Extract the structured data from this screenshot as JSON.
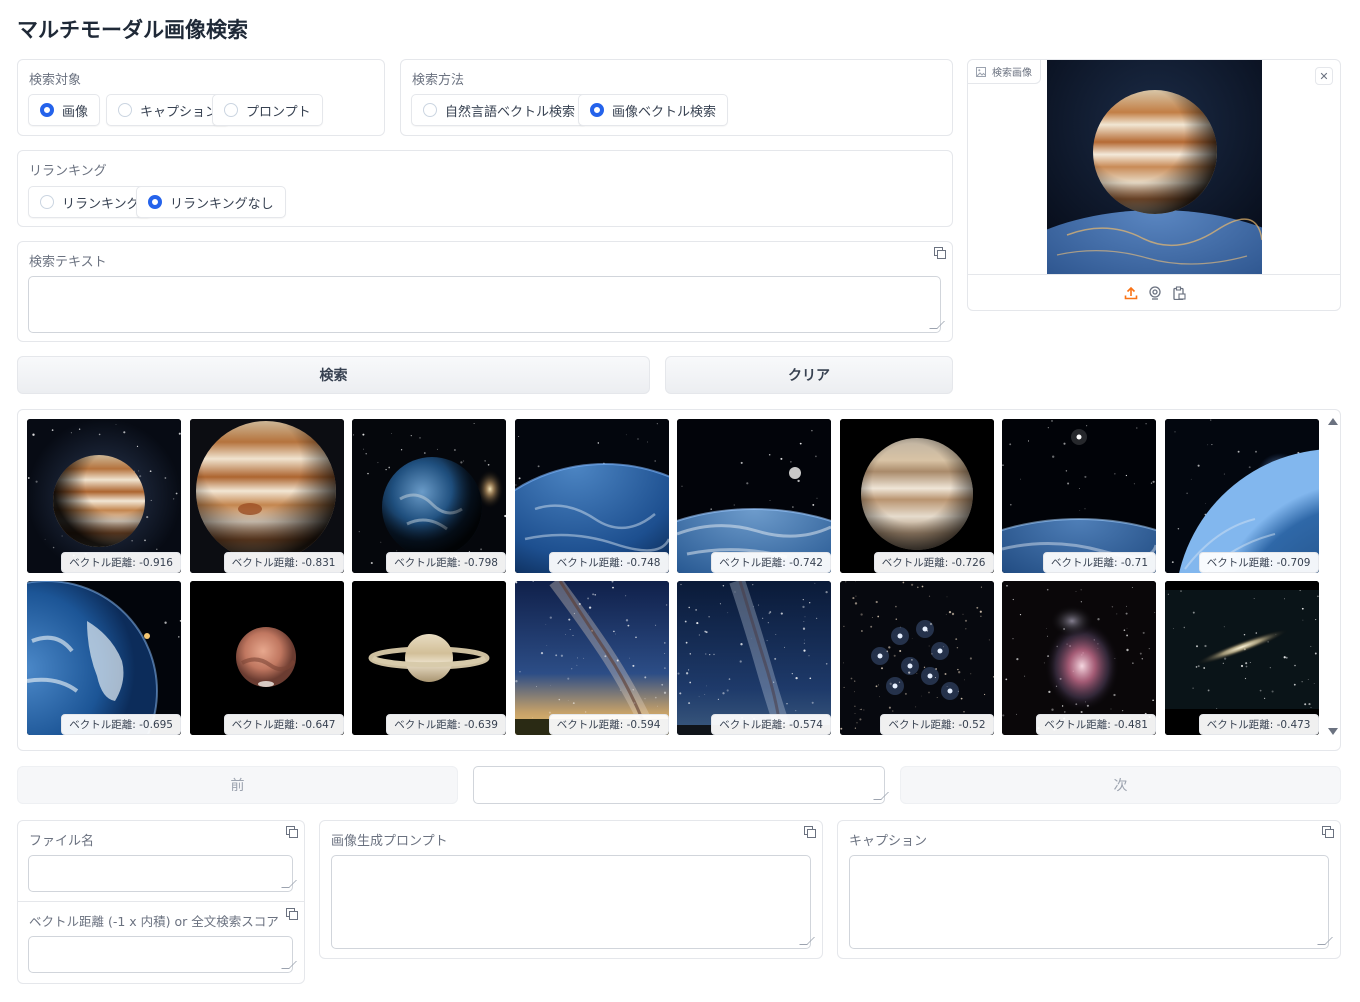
{
  "app": {
    "title": "マルチモーダル画像検索"
  },
  "search_target": {
    "label": "検索対象",
    "options": [
      "画像",
      "キャプション",
      "プロンプト"
    ],
    "selected": 0
  },
  "search_method": {
    "label": "検索方法",
    "options": [
      "自然言語ベクトル検索",
      "画像ベクトル検索"
    ],
    "selected": 1
  },
  "reranking": {
    "label": "リランキング",
    "options": [
      "リランキング",
      "リランキングなし"
    ],
    "selected": 1
  },
  "search_text": {
    "label": "検索テキスト",
    "value": ""
  },
  "search_image": {
    "label": "検索画像"
  },
  "buttons": {
    "search": "検索",
    "clear": "クリア",
    "prev": "前",
    "next": "次"
  },
  "page_field": {
    "value": ""
  },
  "results": [
    {
      "caption": "ベクトル距離: -0.916",
      "icon": "jupiter-thumbnail"
    },
    {
      "caption": "ベクトル距離: -0.831",
      "icon": "jupiter-closeup-thumbnail"
    },
    {
      "caption": "ベクトル距離: -0.798",
      "icon": "earth-galaxy-thumbnail"
    },
    {
      "caption": "ベクトル距離: -0.748",
      "icon": "earth-horizon-thumbnail"
    },
    {
      "caption": "ベクトル距離: -0.742",
      "icon": "earth-moon-thumbnail"
    },
    {
      "caption": "ベクトル距離: -0.726",
      "icon": "jupiter-black-thumbnail"
    },
    {
      "caption": "ベクトル距離: -0.71",
      "icon": "earth-star-thumbnail"
    },
    {
      "caption": "ベクトル距離: -0.709",
      "icon": "earth-sunrise-thumbnail"
    },
    {
      "caption": "ベクトル距離: -0.695",
      "icon": "earth-globe-thumbnail"
    },
    {
      "caption": "ベクトル距離: -0.647",
      "icon": "mars-thumbnail"
    },
    {
      "caption": "ベクトル距離: -0.639",
      "icon": "saturn-thumbnail"
    },
    {
      "caption": "ベクトル距離: -0.594",
      "icon": "milky-way-field-thumbnail"
    },
    {
      "caption": "ベクトル距離: -0.574",
      "icon": "milky-way-thumbnail"
    },
    {
      "caption": "ベクトル距離: -0.52",
      "icon": "pleiades-thumbnail"
    },
    {
      "caption": "ベクトル距離: -0.481",
      "icon": "orion-nebula-thumbnail"
    },
    {
      "caption": "ベクトル距離: -0.473",
      "icon": "edge-on-galaxy-thumbnail"
    }
  ],
  "detail": {
    "filename_label": "ファイル名",
    "filename_value": "",
    "distance_label": "ベクトル距離 (-1 x 内積) or 全文検索スコア",
    "distance_value": "",
    "prompt_label": "画像生成プロンプト",
    "prompt_value": "",
    "caption_label": "キャプション",
    "caption_value": ""
  },
  "colors": {
    "accent": "#2563eb",
    "upload": "#f97316"
  }
}
